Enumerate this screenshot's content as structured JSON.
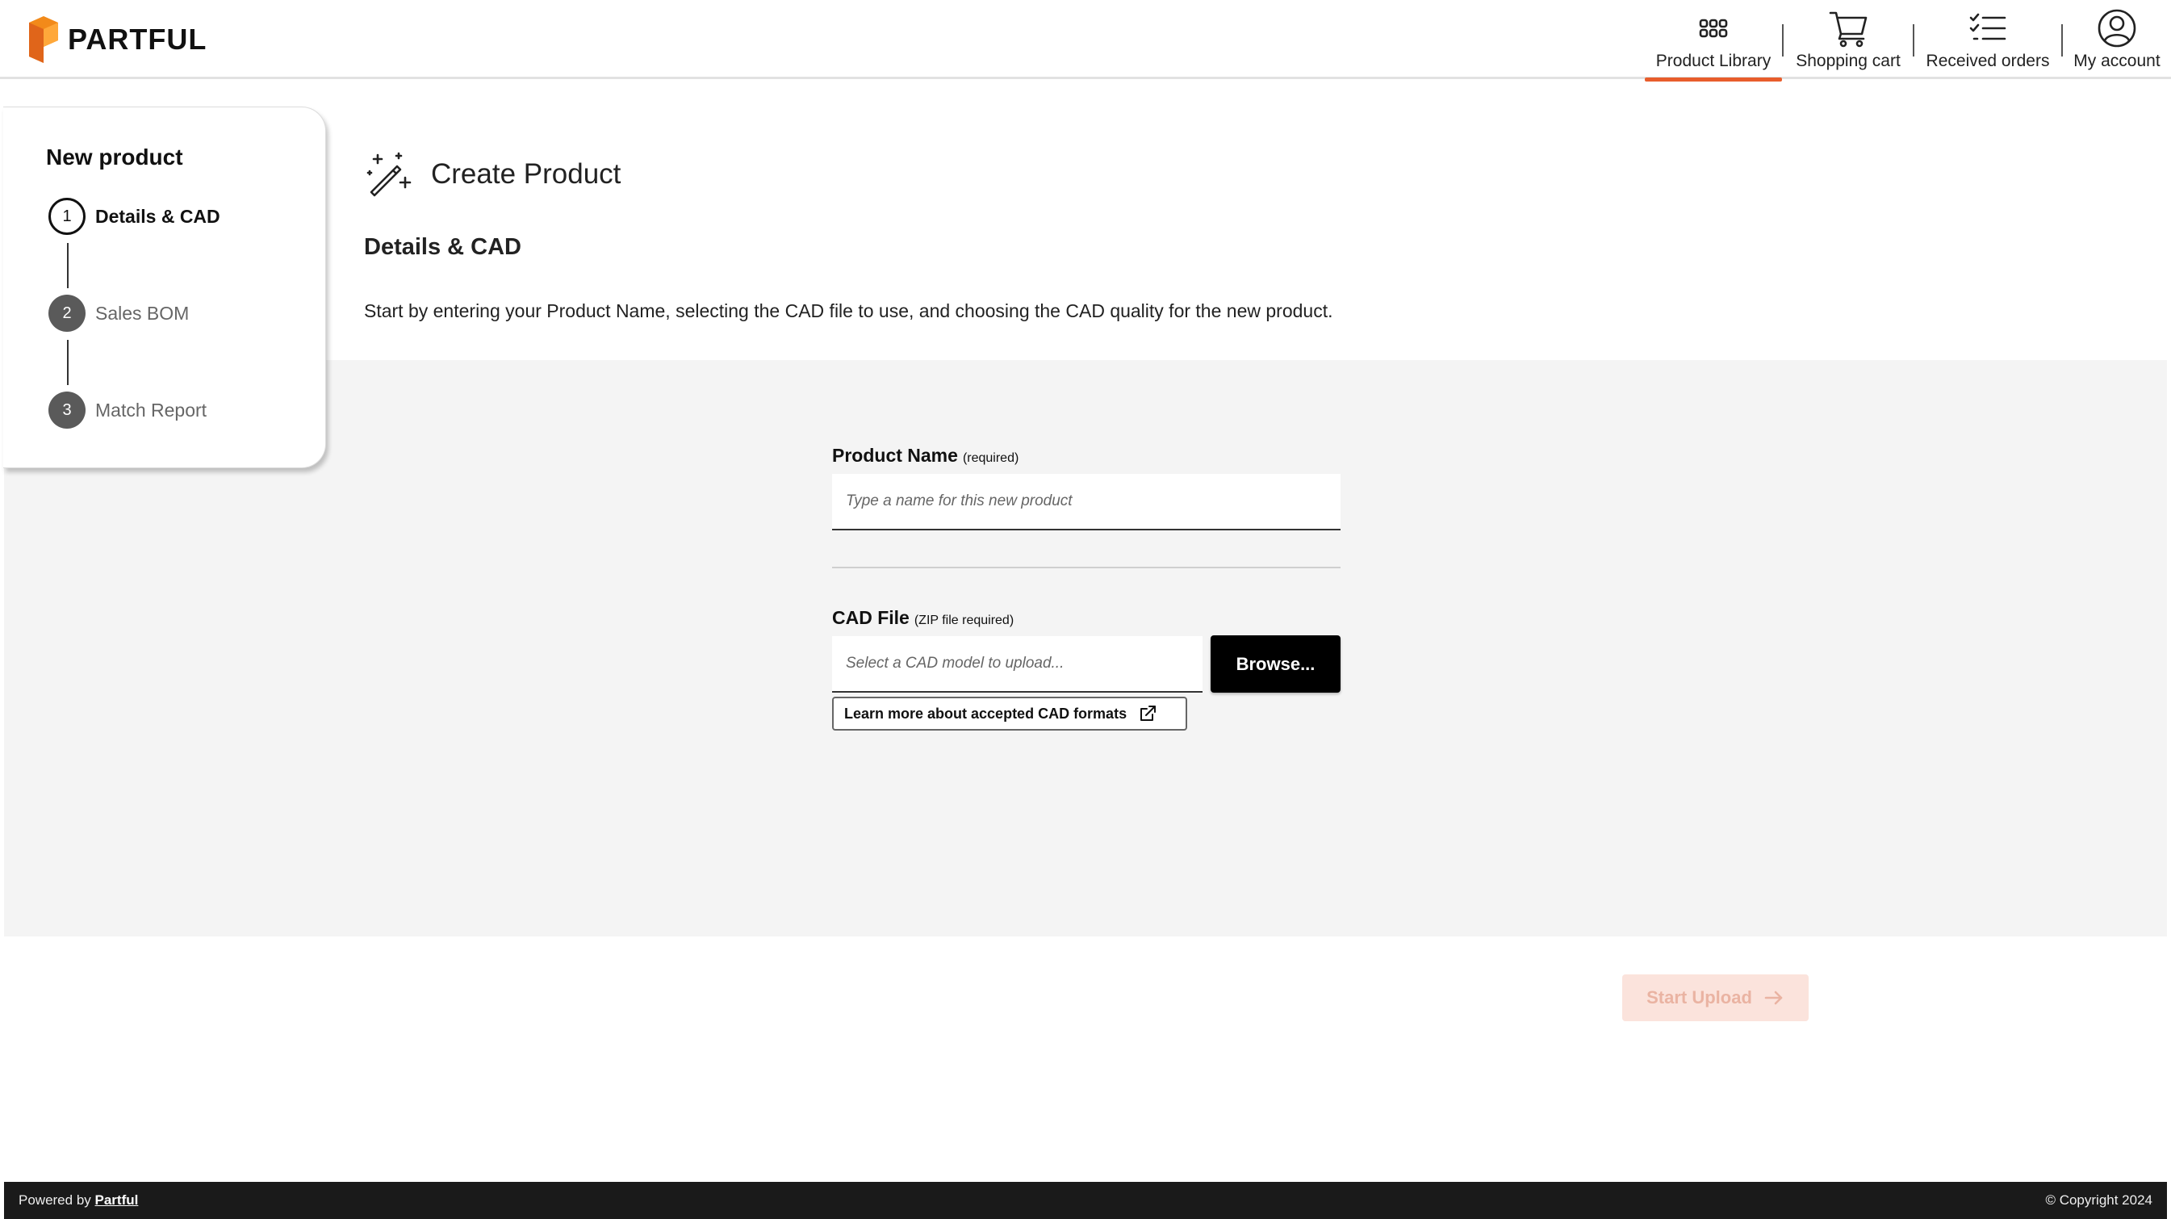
{
  "brand": {
    "name": "PARTFUL",
    "accent_color": "#e85d2c",
    "logo_color": "#f28a1a"
  },
  "nav": {
    "items": [
      {
        "label": "Product Library",
        "icon": "grid-icon",
        "active": true
      },
      {
        "label": "Shopping cart",
        "icon": "cart-icon",
        "active": false
      },
      {
        "label": "Received orders",
        "icon": "checklist-icon",
        "active": false
      },
      {
        "label": "My account",
        "icon": "user-circle-icon",
        "active": false
      }
    ]
  },
  "sidebar": {
    "title": "New product",
    "steps": [
      {
        "number": "1",
        "label": "Details & CAD",
        "state": "current"
      },
      {
        "number": "2",
        "label": "Sales BOM",
        "state": "pending"
      },
      {
        "number": "3",
        "label": "Match Report",
        "state": "pending"
      }
    ]
  },
  "main": {
    "page_title": "Create Product",
    "section_title": "Details & CAD",
    "description": "Start by entering your Product Name, selecting the CAD file to use, and choosing the CAD quality for the new product."
  },
  "form": {
    "product_name": {
      "label": "Product Name",
      "hint": "(required)",
      "value": "",
      "placeholder": "Type a name for this new product"
    },
    "cad_file": {
      "label": "CAD File",
      "hint": "(ZIP file required)",
      "value": "",
      "placeholder": "Select a CAD model to upload..."
    },
    "browse_label": "Browse...",
    "learn_more_label": "Learn more about accepted CAD formats",
    "start_upload_label": "Start Upload"
  },
  "footer": {
    "powered_by": "Powered by",
    "powered_by_link": "Partful",
    "copyright": "© Copyright 2024"
  }
}
